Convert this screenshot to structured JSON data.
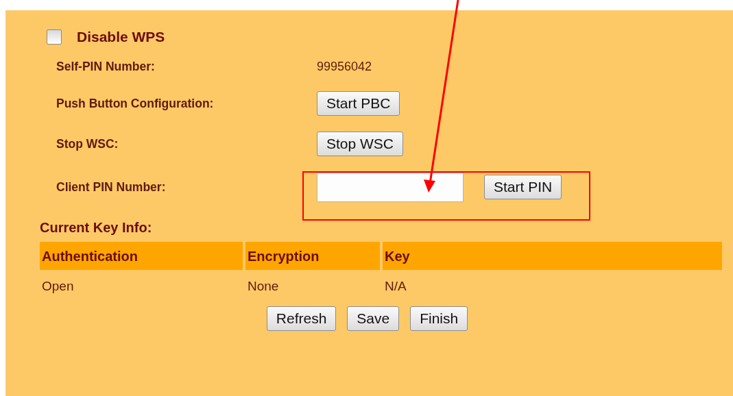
{
  "disable_wps": {
    "label": "Disable WPS",
    "checked": false
  },
  "settings": [
    {
      "kind": "text",
      "label": "Self-PIN Number:",
      "value": "99956042"
    },
    {
      "kind": "button",
      "label": "Push Button Configuration:",
      "button": "Start PBC"
    },
    {
      "kind": "button",
      "label": "Stop WSC:",
      "button": "Stop WSC"
    },
    {
      "kind": "input",
      "label": "Client PIN Number:",
      "button": "Start PIN"
    }
  ],
  "key_info": {
    "title": "Current Key Info:",
    "columns": [
      "Authentication",
      "Encryption",
      "Key"
    ],
    "rows": [
      [
        "Open",
        "None",
        "N/A"
      ]
    ]
  },
  "buttons": [
    "Refresh",
    "Save",
    "Finish"
  ]
}
